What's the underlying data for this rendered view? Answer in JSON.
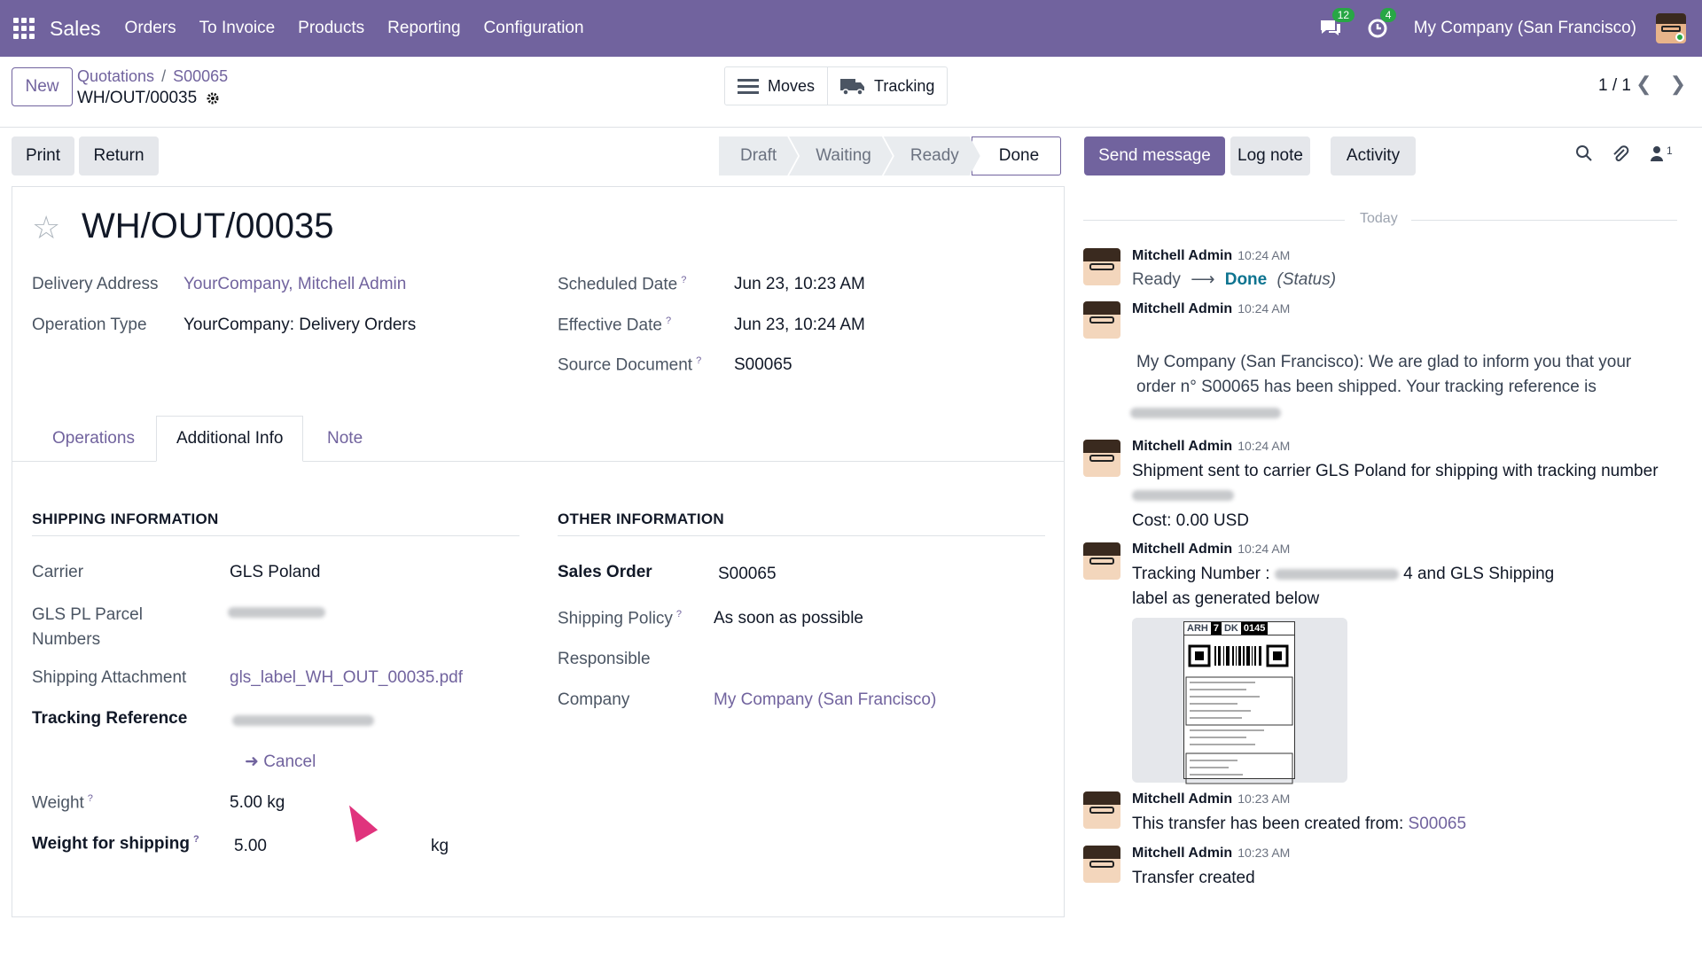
{
  "navbar": {
    "app": "Sales",
    "menus": [
      "Orders",
      "To Invoice",
      "Products",
      "Reporting",
      "Configuration"
    ],
    "messages_count": "12",
    "activities_count": "4",
    "company": "My Company (San Francisco)"
  },
  "control_panel": {
    "new_label": "New",
    "breadcrumb": [
      "Quotations",
      "S00065"
    ],
    "record": "WH/OUT/00035",
    "smart_buttons": [
      "Moves",
      "Tracking"
    ],
    "pager": "1 / 1"
  },
  "actions": {
    "print": "Print",
    "return": "Return"
  },
  "statusbar": [
    "Draft",
    "Waiting",
    "Ready",
    "Done"
  ],
  "status_active": "Done",
  "form": {
    "title": "WH/OUT/00035",
    "delivery_address_label": "Delivery Address",
    "delivery_address": "YourCompany, Mitchell Admin",
    "operation_type_label": "Operation Type",
    "operation_type": "YourCompany: Delivery Orders",
    "scheduled_date_label": "Scheduled Date",
    "scheduled_date": "Jun 23, 10:23 AM",
    "effective_date_label": "Effective Date",
    "effective_date": "Jun 23, 10:24 AM",
    "source_document_label": "Source Document",
    "source_document": "S00065",
    "tabs": [
      "Operations",
      "Additional Info",
      "Note"
    ],
    "shipping_header": "SHIPPING INFORMATION",
    "carrier_label": "Carrier",
    "carrier": "GLS Poland",
    "gls_label": "GLS PL Parcel Numbers",
    "attachment_label": "Shipping Attachment",
    "attachment": "gls_label_WH_OUT_00035.pdf",
    "tracking_ref_label": "Tracking Reference",
    "cancel_label": "Cancel",
    "weight_label": "Weight",
    "weight": "5.00 kg",
    "weight_shipping_label": "Weight for shipping",
    "weight_shipping": "5.00",
    "weight_unit": "kg",
    "other_header": "OTHER INFORMATION",
    "sales_order_label": "Sales Order",
    "sales_order": "S00065",
    "shipping_policy_label": "Shipping Policy",
    "shipping_policy": "As soon as possible",
    "responsible_label": "Responsible",
    "company_label": "Company",
    "company": "My Company (San Francisco)"
  },
  "chatter": {
    "send_message": "Send message",
    "log_note": "Log note",
    "activity": "Activity",
    "followers": "1",
    "today": "Today",
    "messages": [
      {
        "author": "Mitchell Admin",
        "time": "10:24 AM",
        "from": "Ready",
        "to": "Done",
        "field": "(Status)"
      },
      {
        "author": "Mitchell Admin",
        "time": "10:24 AM",
        "body": "My Company (San Francisco): We are glad to inform you that your order n° S00065 has been shipped. Your tracking reference is"
      },
      {
        "author": "Mitchell Admin",
        "time": "10:24 AM",
        "body": "Shipment sent to carrier GLS Poland for shipping with tracking number",
        "cost": "Cost: 0.00 USD"
      },
      {
        "author": "Mitchell Admin",
        "time": "10:24 AM",
        "body_a": "Tracking Number :",
        "body_b": "4 and GLS Shipping label as generated below"
      },
      {
        "author": "Mitchell Admin",
        "time": "10:23 AM",
        "body": "This transfer has been created from:",
        "link": "S00065"
      },
      {
        "author": "Mitchell Admin",
        "time": "10:23 AM",
        "body": "Transfer created"
      }
    ],
    "shipping_label": {
      "a": "ARH",
      "b": "7",
      "c": "DK",
      "d": "0145"
    }
  },
  "colors": {
    "brand": "#71639e",
    "link": "#71639e",
    "success": "#28a745"
  }
}
